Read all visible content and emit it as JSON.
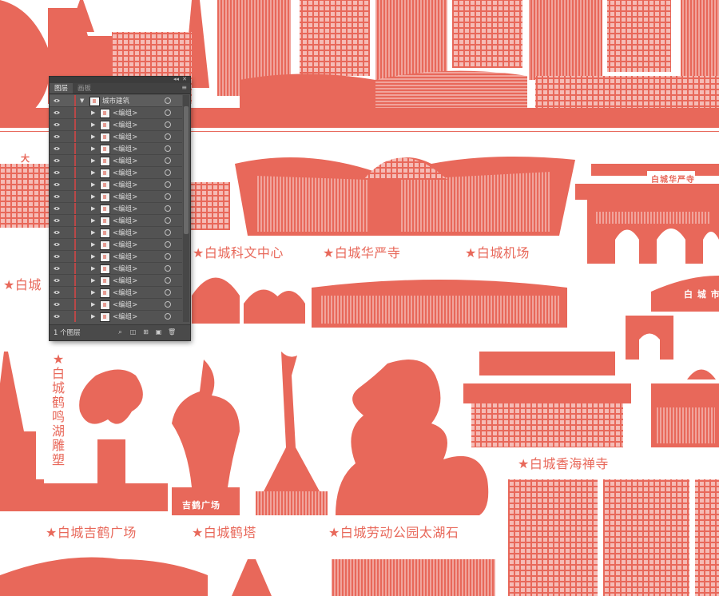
{
  "colors": {
    "brand": "#e8685a",
    "panel_bg": "#535353",
    "panel_dark": "#3c3c3c"
  },
  "labels": {
    "science_center": "★白城科文中心",
    "huayan_temple": "★白城华严寺",
    "airport": "★白城机场",
    "left_cut": "★白城",
    "crane_lake_sculpture": "★白城鹤鸣湖雕塑",
    "jihe_square": "★白城吉鹤广场",
    "crane_tower": "★白城鹤塔",
    "taihu_stone": "★白城劳动公园太湖石",
    "xianghai_temple": "★白城香海禅寺"
  },
  "signs": {
    "huayan_plaque": "白城华严寺",
    "jihe_base": "吉鹤广场",
    "gate_sign": "白 城 市",
    "small_top_left": "大"
  },
  "layers_panel": {
    "tabs": [
      "图层",
      "画板"
    ],
    "active_tab": "图层",
    "parent_layer": "城市建筑",
    "group_label": "<编组>",
    "group_count": 18,
    "footer_count": "1 个图层",
    "footer_icons": [
      "search-icon",
      "clipping-mask-icon",
      "new-sublayer-icon",
      "new-layer-icon",
      "delete-icon"
    ]
  }
}
